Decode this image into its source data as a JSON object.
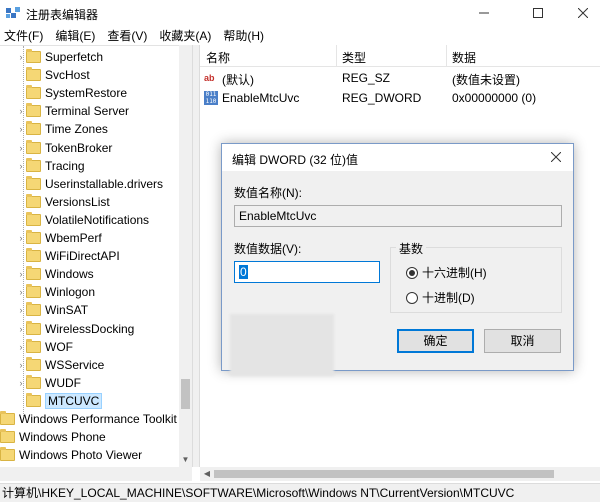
{
  "window": {
    "title": "注册表编辑器"
  },
  "menu": [
    "文件(F)",
    "编辑(E)",
    "查看(V)",
    "收藏夹(A)",
    "帮助(H)"
  ],
  "tree": {
    "children": [
      "Superfetch",
      "SvcHost",
      "SystemRestore",
      "Terminal Server",
      "Time Zones",
      "TokenBroker",
      "Tracing",
      "Userinstallable.drivers",
      "VersionsList",
      "VolatileNotifications",
      "WbemPerf",
      "WiFiDirectAPI",
      "Windows",
      "Winlogon",
      "WinSAT",
      "WirelessDocking",
      "WOF",
      "WSService",
      "WUDF",
      "MTCUVC"
    ],
    "expandable": [
      true,
      false,
      false,
      true,
      true,
      true,
      true,
      false,
      false,
      false,
      true,
      false,
      true,
      true,
      true,
      true,
      true,
      true,
      true,
      false
    ],
    "selected": "MTCUVC",
    "root_items": [
      "Windows Performance Toolkit",
      "Windows Phone",
      "Windows Photo Viewer"
    ]
  },
  "list": {
    "columns": [
      "名称",
      "类型",
      "数据"
    ],
    "rows": [
      {
        "icon": "string-value-icon",
        "name": "(默认)",
        "type": "REG_SZ",
        "data": "(数值未设置)"
      },
      {
        "icon": "binary-value-icon",
        "name": "EnableMtcUvc",
        "type": "REG_DWORD",
        "data": "0x00000000 (0)"
      }
    ]
  },
  "status": {
    "path": "计算机\\HKEY_LOCAL_MACHINE\\SOFTWARE\\Microsoft\\Windows NT\\CurrentVersion\\MTCUVC"
  },
  "dialog": {
    "title": "编辑 DWORD (32 位)值",
    "name_label": "数值名称(N):",
    "name_value": "EnableMtcUvc",
    "data_label": "数值数据(V):",
    "data_value": "0",
    "base_label": "基数",
    "radio_hex": "十六进制(H)",
    "radio_dec": "十进制(D)",
    "base_selected": "hex",
    "ok": "确定",
    "cancel": "取消"
  },
  "colors": {
    "accent": "#0078d7",
    "selection": "#cce8ff",
    "folder": "#f5d775"
  }
}
